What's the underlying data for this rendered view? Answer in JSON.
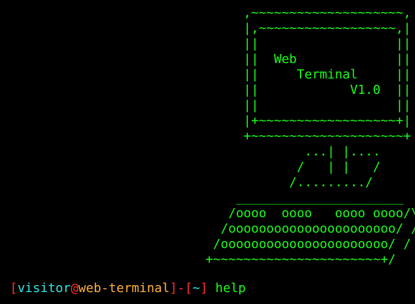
{
  "terminal": {
    "colors": {
      "background": "#000000",
      "art": "#19ff19",
      "bracket": "#ff2d2d",
      "user": "#2ee6e6",
      "host": "#ffb23a",
      "command": "#19ff19"
    },
    "ascii_art": [
      "                                ,~~~~~~~~~~~~~~~~~~~~,",
      "                                |,~~~~~~~~~~~~~~~~~~,|",
      "                                ||                  ||",
      "                                ||  Web             ||",
      "                                ||     Terminal     ||",
      "                                ||            V1.0  ||",
      "                                ||                  ||",
      "                                |+~~~~~~~~~~~~~~~~~~+|",
      "                                +~~~~~~~~~~~~~~~~~~~~+",
      "                                        ...| |....",
      "                                       /   | |   /",
      "                                      /........./",
      "                               ______________________",
      "                              /oooo  oooo   oooo oooo/\\",
      "                             /oooooooooooooooooooooo/ /",
      "                            /oooooooooooooooooooooo/ /",
      "                           +~~~~~~~~~~~~~~~~~~~~~~+/"
    ],
    "prompt": {
      "open_bracket": "[",
      "user": "visitor",
      "at": "@",
      "host": "web-terminal",
      "close_bracket": "]",
      "separator": "-",
      "dir_open": "[",
      "dir": "~",
      "dir_close": "]",
      "command": "help"
    }
  }
}
